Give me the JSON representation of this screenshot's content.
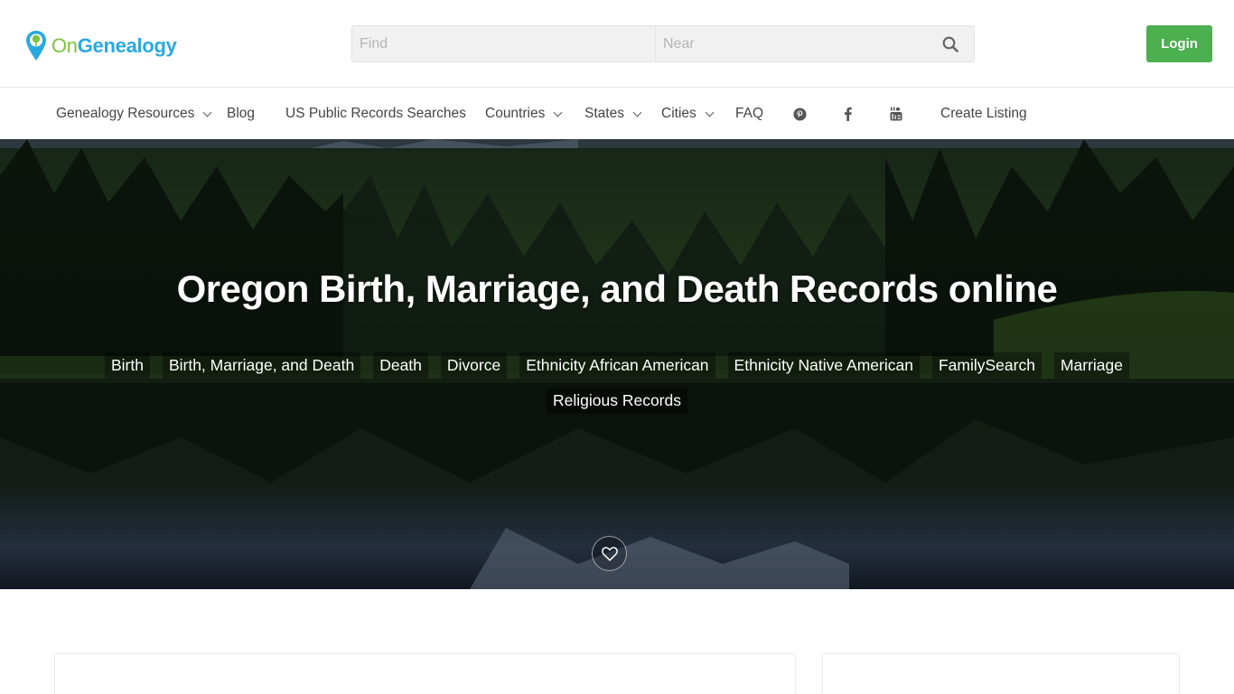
{
  "header": {
    "logo": {
      "part1": "On",
      "part2": "Genealogy"
    },
    "search": {
      "find_placeholder": "Find",
      "near_placeholder": "Near"
    },
    "login_label": "Login"
  },
  "nav": {
    "items": [
      {
        "label": "Genealogy Resources",
        "has_dropdown": true
      },
      {
        "label": "Blog",
        "has_dropdown": false
      },
      {
        "label": "US Public Records Searches",
        "has_dropdown": false
      },
      {
        "label": "Countries",
        "has_dropdown": true
      },
      {
        "label": "States",
        "has_dropdown": true
      },
      {
        "label": "Cities",
        "has_dropdown": true
      },
      {
        "label": "FAQ",
        "has_dropdown": false
      }
    ],
    "social_icons": [
      "pinterest-icon",
      "facebook-icon",
      "youtube-icon"
    ],
    "create_listing_label": "Create Listing"
  },
  "hero": {
    "title": "Oregon Birth, Marriage, and Death Records online",
    "tags_row1": [
      "Birth",
      "Birth, Marriage, and Death",
      "Death",
      "Divorce",
      "Ethnicity African American",
      "Ethnicity Native American",
      "FamilySearch",
      "Marriage"
    ],
    "tags_row2": [
      "Religious Records"
    ],
    "favorite_icon": "heart-icon"
  },
  "colors": {
    "accent_green": "#4caf50",
    "logo_green": "#7cc242",
    "logo_blue": "#2aa9df"
  }
}
